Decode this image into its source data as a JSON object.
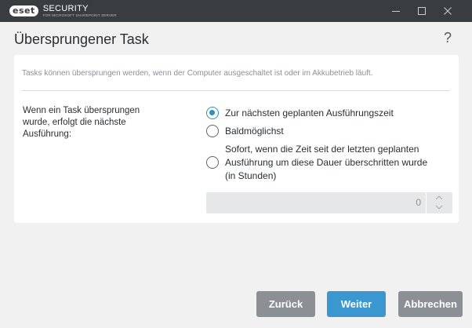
{
  "app": {
    "logo_badge": "eset",
    "logo_main": "SECURITY",
    "logo_sub": "FOR MICROSOFT SHAREPOINT SERVER"
  },
  "header": {
    "title": "Übersprungener Task",
    "help": "?"
  },
  "panel": {
    "description": "Tasks können übersprungen werden, wenn der Computer ausgeschaltet ist oder im Akkubetrieb läuft.",
    "field_label": "Wenn ein Task übersprungen wurde, erfolgt die nächste Ausführung:",
    "options": [
      {
        "label": "Zur nächsten geplanten Ausführungszeit",
        "checked": true
      },
      {
        "label": "Baldmöglichst",
        "checked": false
      },
      {
        "label": "Sofort, wenn die Zeit seit der letzten geplanten Ausführung um diese Dauer überschritten wurde (in Stunden)",
        "checked": false
      }
    ],
    "hours_value": "0"
  },
  "footer": {
    "back_label": "Zurück",
    "next_label": "Weiter",
    "cancel_label": "Abbrechen"
  },
  "icons": {
    "minimize": "minimize-icon",
    "maximize": "maximize-icon",
    "close": "close-icon",
    "spin_up": "chevron-up-icon",
    "spin_down": "chevron-down-icon"
  },
  "colors": {
    "titlebar": "#3a3d40",
    "accent": "#3a97d0",
    "radio_checked": "#2e8ec8",
    "secondary_button": "#8c9094",
    "background": "#f1f1f1"
  }
}
